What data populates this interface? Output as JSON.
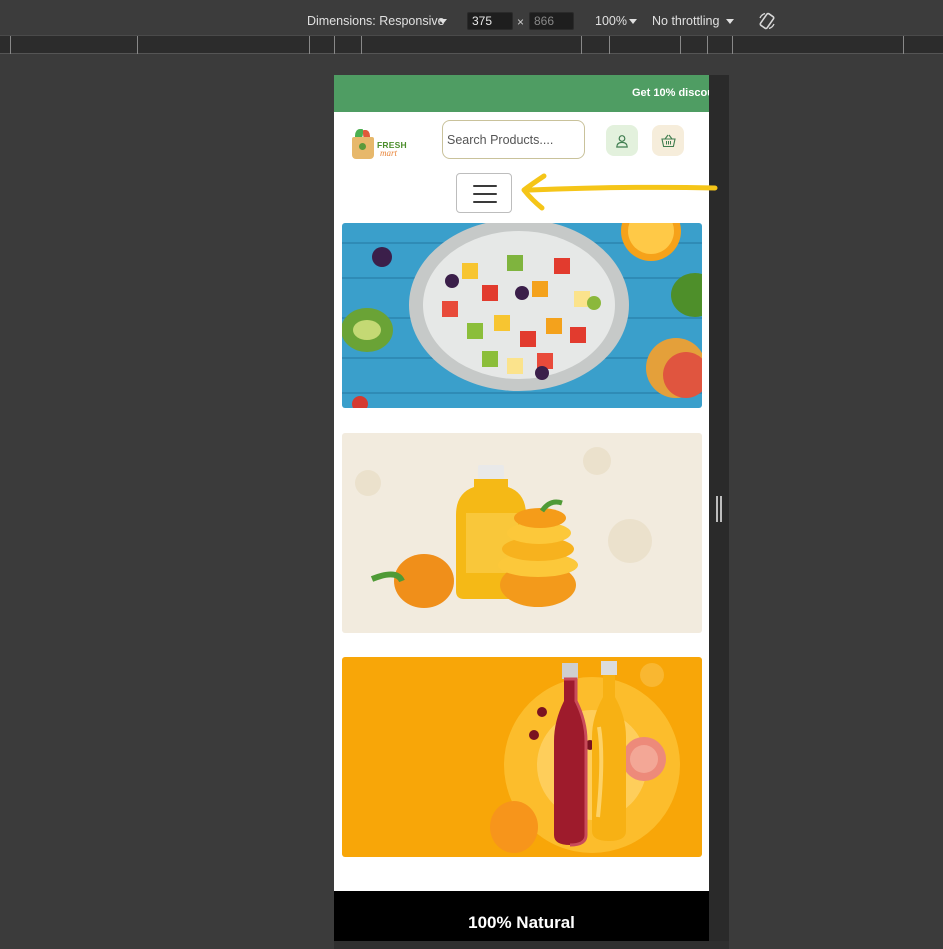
{
  "devtools": {
    "dimensions_label": "Dimensions: Responsive",
    "width_value": "375",
    "height_value": "866",
    "times_glyph": "×",
    "zoom": "100%",
    "throttling": "No throttling"
  },
  "page": {
    "promo_text": "Get 10% discou",
    "logo": {
      "word1": "FRESH",
      "word2": "mart"
    },
    "search_placeholder": "Search Products....",
    "icons": {
      "account": "user-icon",
      "cart": "basket-icon",
      "menu": "hamburger-menu-icon",
      "rotate": "rotate-device-icon"
    },
    "banners": [
      {
        "subject": "fruit-salad"
      },
      {
        "subject": "juice-bottle-oranges"
      },
      {
        "subject": "joogi-juice-bottles"
      }
    ],
    "natural_heading": "100% Natural"
  },
  "annotation": {
    "color": "#f5c518"
  },
  "colors": {
    "promo": "#4f9d63",
    "user_bg": "#e3f1dd",
    "cart_bg": "#f6eddb",
    "devtools_bg": "#3c3c3c"
  }
}
